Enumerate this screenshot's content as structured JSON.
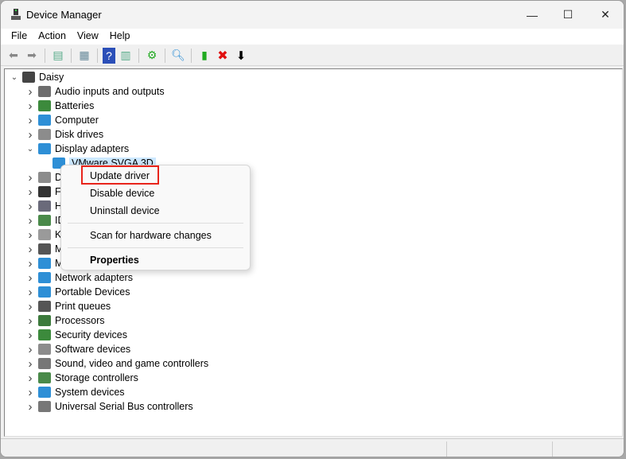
{
  "window": {
    "title": "Device Manager",
    "minimize": "—",
    "maximize": "☐",
    "close": "✕"
  },
  "menubar": [
    "File",
    "Action",
    "View",
    "Help"
  ],
  "toolbar": {
    "icons": [
      "back-icon",
      "forward-icon",
      "show-hide-console-tree-icon",
      "properties-icon",
      "help-icon",
      "show-action-pane-icon",
      "update-driver-icon",
      "scan-hardware-icon",
      "enable-device-icon",
      "uninstall-device-icon",
      "disable-device-icon"
    ]
  },
  "tree": {
    "root": "Daisy",
    "items": [
      {
        "label": "Audio inputs and outputs",
        "icon": "#6d6d6d"
      },
      {
        "label": "Batteries",
        "icon": "#3c8a3c"
      },
      {
        "label": "Computer",
        "icon": "#2e8fd6"
      },
      {
        "label": "Disk drives",
        "icon": "#8c8c8c"
      },
      {
        "label": "Display adapters",
        "icon": "#2e8fd6",
        "expanded": true,
        "children": [
          {
            "label": "VMware SVGA 3D",
            "selected": true
          }
        ]
      },
      {
        "label": "D",
        "icon": "#8c8c8c"
      },
      {
        "label": "Fi",
        "icon": "#333333"
      },
      {
        "label": "H",
        "icon": "#6a6a7a"
      },
      {
        "label": "ID",
        "icon": "#4a8a4a"
      },
      {
        "label": "K",
        "icon": "#9a9a9a"
      },
      {
        "label": "M",
        "icon": "#555555"
      },
      {
        "label": "M",
        "icon": "#2e8fd6"
      },
      {
        "label": "Network adapters",
        "icon": "#2e8fd6"
      },
      {
        "label": "Portable Devices",
        "icon": "#2e8fd6"
      },
      {
        "label": "Print queues",
        "icon": "#555555"
      },
      {
        "label": "Processors",
        "icon": "#3c7a3c"
      },
      {
        "label": "Security devices",
        "icon": "#3c8a3c"
      },
      {
        "label": "Software devices",
        "icon": "#8c8c8c"
      },
      {
        "label": "Sound, video and game controllers",
        "icon": "#777777"
      },
      {
        "label": "Storage controllers",
        "icon": "#4a8a4a"
      },
      {
        "label": "System devices",
        "icon": "#2e8fd6"
      },
      {
        "label": "Universal Serial Bus controllers",
        "icon": "#777777"
      }
    ]
  },
  "context_menu": {
    "items": [
      "Update driver",
      "Disable device",
      "Uninstall device",
      "Scan for hardware changes",
      "Properties"
    ],
    "highlight_color": "#e8241b"
  }
}
